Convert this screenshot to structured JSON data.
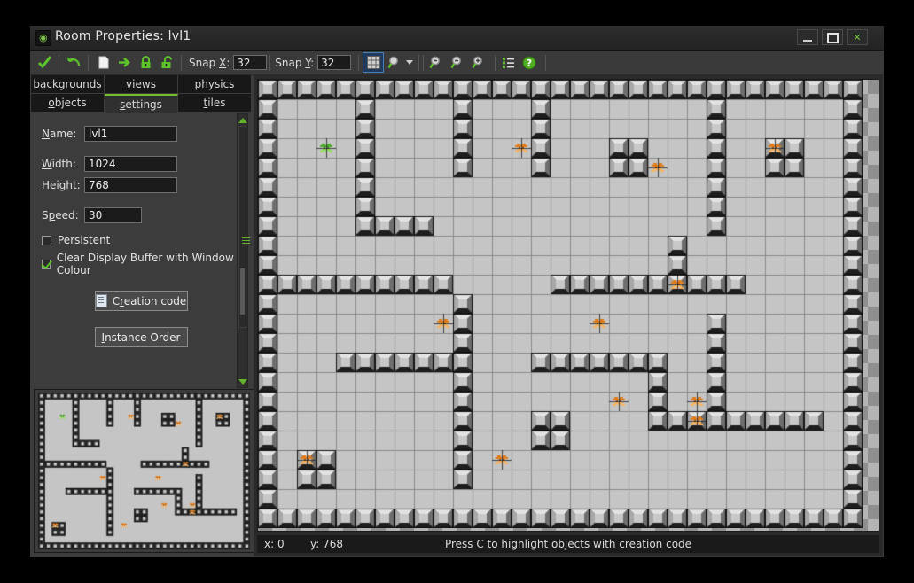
{
  "window": {
    "title": "Room Properties: lvl1",
    "app_icon": "gamemaker-icon",
    "minimize_label": "",
    "maximize_label": "",
    "close_label": "✕"
  },
  "toolbar": {
    "buttons": [
      {
        "name": "confirm-ok-icon",
        "glyph": "check"
      },
      {
        "name": "undo-icon",
        "glyph": "undo"
      },
      {
        "name": "new-page-icon",
        "glyph": "page"
      },
      {
        "name": "arrow-right-icon",
        "glyph": "arrow"
      },
      {
        "name": "lock-closed-icon",
        "glyph": "lock"
      },
      {
        "name": "lock-open-icon",
        "glyph": "unlock"
      }
    ],
    "snap_x_label": "Snap X:",
    "snap_x_value": "32",
    "snap_y_label": "Snap Y:",
    "snap_y_value": "32",
    "grid_toggle": "grid-icon",
    "zoom_tool": "magnifier-icon",
    "zoom_out": "zoom-out-icon",
    "zoom_reset": "zoom-reset-icon",
    "zoom_in": "zoom-in-icon",
    "list_icon": "list-icon",
    "help_icon": "help-icon"
  },
  "tabs": {
    "row1": [
      {
        "label": "backgrounds",
        "mnemonic": "b",
        "active": false
      },
      {
        "label": "views",
        "mnemonic": "v",
        "active": false
      },
      {
        "label": "physics",
        "mnemonic": "p",
        "active": false
      }
    ],
    "row2": [
      {
        "label": "objects",
        "mnemonic": "o",
        "active": false
      },
      {
        "label": "settings",
        "mnemonic": "s",
        "active": true
      },
      {
        "label": "tiles",
        "mnemonic": "t",
        "active": false
      }
    ]
  },
  "settings": {
    "name_label": "Name:",
    "name_mnemonic": "N",
    "name_value": "lvl1",
    "width_label": "Width:",
    "width_mnemonic": "W",
    "width_value": "1024",
    "height_label": "Height:",
    "height_mnemonic": "H",
    "height_value": "768",
    "speed_label": "Speed:",
    "speed_mnemonic": "p",
    "speed_value": "30",
    "persistent_label": "Persistent",
    "persistent_mnemonic": "rs",
    "persistent_checked": false,
    "clear_buffer_label": "Clear Display Buffer with Window Colour",
    "clear_buffer_checked": true,
    "creation_code_label": "Creation code",
    "creation_code_mnemonic": "r",
    "instance_order_label": "Instance Order",
    "instance_order_mnemonic": "I"
  },
  "status": {
    "x_label": "x: 0",
    "y_label": "y: 768",
    "hint": "Press C to highlight objects with creation code"
  },
  "colors": {
    "accent_green": "#76bb2e",
    "window_bg": "#3c3c3c",
    "panel_bg": "#303030",
    "field_bg": "#1b1b1b",
    "tile_face": "#c8c8c8",
    "tile_dark": "#2b2b2b",
    "room_floor": "#c5c5c5",
    "sprite_orange": "#e07b1a",
    "sprite_green": "#4ca82a"
  },
  "room": {
    "tile_size": 22,
    "cols": 31,
    "rows": 23,
    "floor_color": "#c5c5c5",
    "grid_color": "#8a8a8a",
    "wall_map": [
      "1111111111111111111111111111111",
      "1000010000100010000000010000001",
      "1000010000100010000000010000001",
      "1000010000100010001100010011001",
      "1000010000100010001100010011001",
      "1000010000000000000000010000001",
      "1000010000000000000000010000001",
      "1000011110000000000000010000001",
      "1000000000000000000001000000001",
      "1000000000000000000001000000001",
      "1111111111000001111111111000001",
      "1000000000100000000000000000001",
      "1000000000100000000000010000001",
      "1000000000100000000000010000001",
      "1000111111100011111110010000001",
      "1000000000100000000010010000001",
      "1000000000100000000010010000001",
      "1000000000100011000011111111101",
      "1000000000100011000000000000001",
      "1011000000100000000000000000001",
      "1011000000100000000000000000001",
      "1000000000000000000000000000001",
      "1111111111111111111111111111111"
    ],
    "objects": [
      {
        "col": 3,
        "row": 3,
        "color": "green"
      },
      {
        "col": 13,
        "row": 3,
        "color": "orange"
      },
      {
        "col": 20,
        "row": 4,
        "color": "orange"
      },
      {
        "col": 26,
        "row": 3,
        "color": "orange"
      },
      {
        "col": 21,
        "row": 10,
        "color": "orange"
      },
      {
        "col": 9,
        "row": 12,
        "color": "orange"
      },
      {
        "col": 17,
        "row": 12,
        "color": "orange"
      },
      {
        "col": 18,
        "row": 16,
        "color": "orange"
      },
      {
        "col": 22,
        "row": 16,
        "color": "orange"
      },
      {
        "col": 22,
        "row": 17,
        "color": "orange"
      },
      {
        "col": 2,
        "row": 19,
        "color": "orange"
      },
      {
        "col": 12,
        "row": 19,
        "color": "orange"
      }
    ]
  },
  "minimap": {
    "cols": 31,
    "rows": 23
  }
}
